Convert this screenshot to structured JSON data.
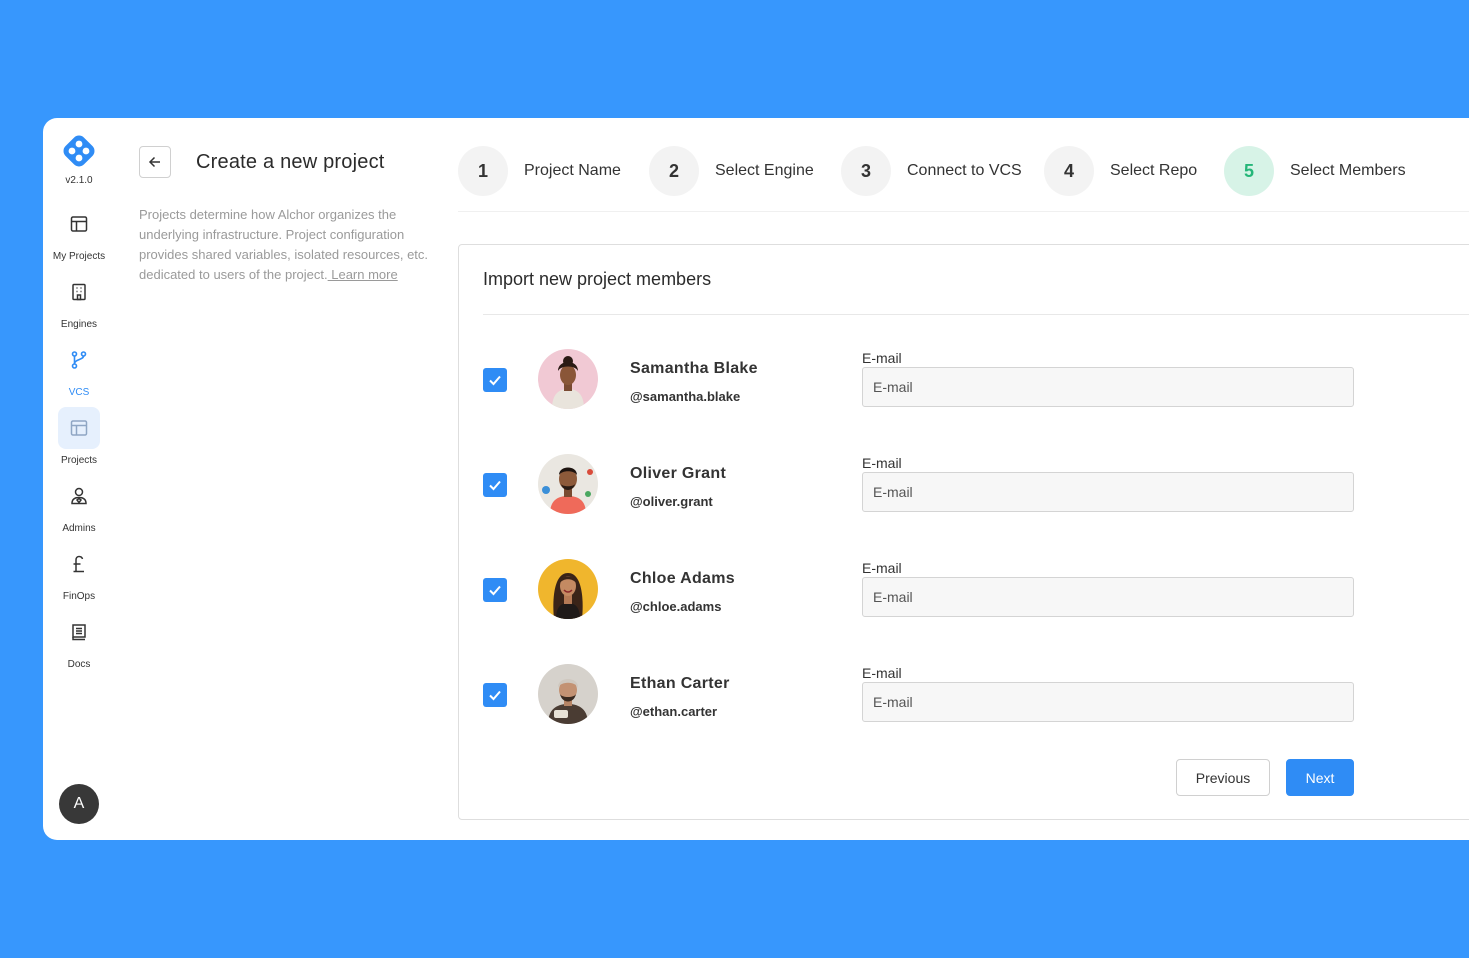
{
  "sidebar": {
    "version": "v2.1.0",
    "items": [
      {
        "label": "My Projects",
        "icon": "layout-icon"
      },
      {
        "label": "Engines",
        "icon": "building-icon"
      },
      {
        "label": "VCS",
        "icon": "git-branch-icon"
      },
      {
        "label": "Projects",
        "icon": "layout-icon"
      },
      {
        "label": "Admins",
        "icon": "user-shield-icon"
      },
      {
        "label": "FinOps",
        "icon": "pound-icon"
      },
      {
        "label": "Docs",
        "icon": "book-icon"
      }
    ],
    "avatar_initial": "A"
  },
  "header": {
    "title": "Create a new project",
    "description": "Projects determine how Alchor organizes the underlying infrastructure.  Project configuration provides shared variables, isolated resources,  etc. dedicated to users of the project.",
    "learn_more": " Learn more"
  },
  "stepper": {
    "steps": [
      {
        "num": "1",
        "label": "Project Name"
      },
      {
        "num": "2",
        "label": "Select Engine"
      },
      {
        "num": "3",
        "label": "Connect to VCS"
      },
      {
        "num": "4",
        "label": "Select Repo"
      },
      {
        "num": "5",
        "label": "Select Members"
      }
    ],
    "current": 5
  },
  "card": {
    "title": "Import new project members",
    "email_label": "E-mail",
    "email_placeholder": "E-mail",
    "members": [
      {
        "name": "Samantha Blake",
        "handle": "@samantha.blake",
        "checked": true
      },
      {
        "name": "Oliver Grant",
        "handle": "@oliver.grant",
        "checked": true
      },
      {
        "name": "Chloe Adams",
        "handle": "@chloe.adams",
        "checked": true
      },
      {
        "name": "Ethan Carter",
        "handle": "@ethan.carter",
        "checked": true
      }
    ],
    "previous_label": "Previous",
    "next_label": "Next"
  },
  "colors": {
    "background": "#3797fd",
    "accent": "#2f8cf5",
    "step_active_bg": "#d7f3e7",
    "step_active_text": "#25b679"
  }
}
